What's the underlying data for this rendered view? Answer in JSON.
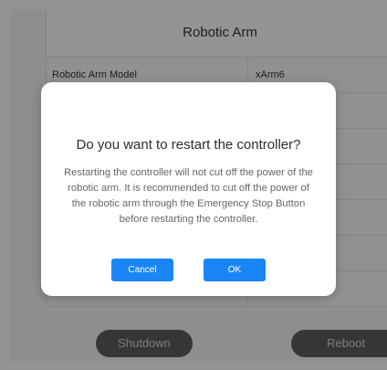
{
  "table": {
    "title": "Robotic Arm",
    "rows": [
      {
        "label": "Robotic Arm Model",
        "value": "xArm6"
      }
    ]
  },
  "bottom_buttons": {
    "shutdown": "Shutdown",
    "reboot": "Reboot"
  },
  "dialog": {
    "title": "Do you want to restart the controller?",
    "message": "Restarting the controller will not cut off the power of the robotic arm. It is recommended to cut off the power of the robotic arm through the Emergency Stop Button before restarting the controller.",
    "cancel_label": "Cancel",
    "ok_label": "OK"
  },
  "colors": {
    "primary_button": "#1a86f6",
    "overlay": "rgba(0,0,0,0.42)"
  }
}
